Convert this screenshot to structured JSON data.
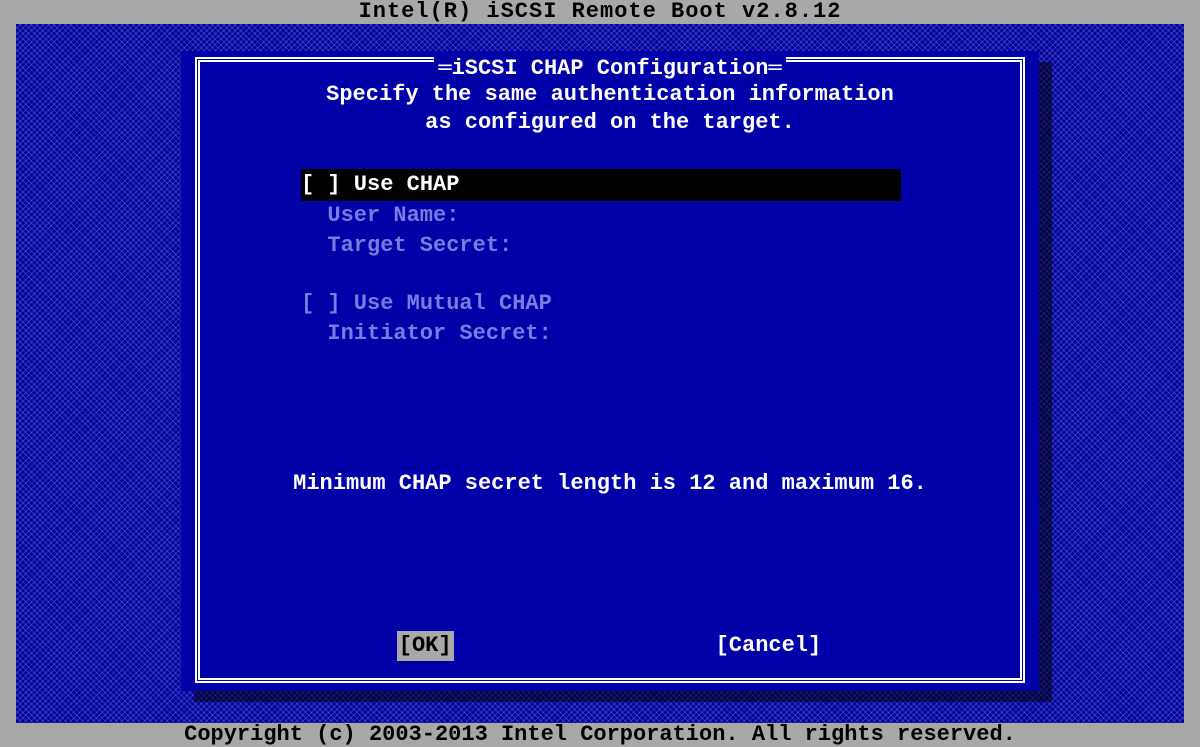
{
  "header": {
    "title": "Intel(R) iSCSI Remote Boot v2.8.12"
  },
  "dialog": {
    "title": "iSCSI CHAP Configuration",
    "instructions_line1": "Specify the same authentication information",
    "instructions_line2": "as configured on the target.",
    "fields": {
      "use_chap": "[ ] Use CHAP",
      "user_name": "User Name:",
      "target_secret": "Target Secret:",
      "use_mutual_chap": "[ ] Use Mutual CHAP",
      "initiator_secret": "Initiator Secret:"
    },
    "hint": "Minimum CHAP secret length is 12 and maximum 16.",
    "buttons": {
      "ok": "[OK]",
      "cancel": "[Cancel]"
    }
  },
  "footer": {
    "copyright": "Copyright (c) 2003-2013 Intel Corporation. All rights reserved."
  }
}
